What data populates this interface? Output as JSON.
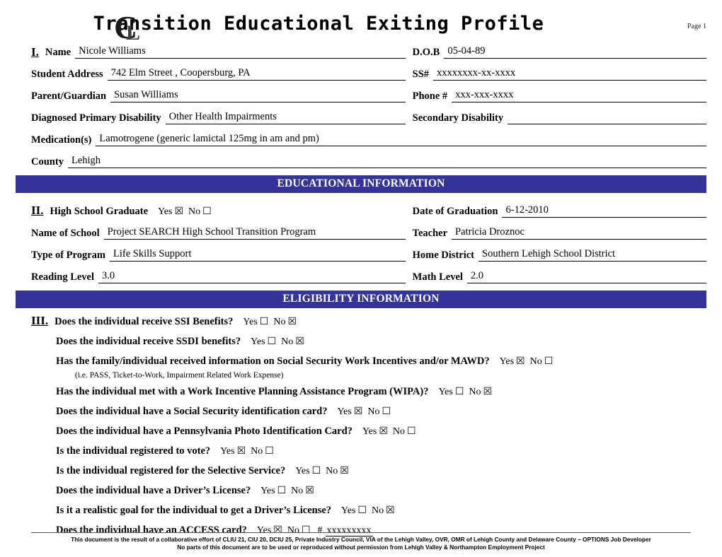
{
  "header": {
    "title": "Transition Educational Exiting Profile",
    "page_label": "Page 1",
    "logo_name": "cl-monogram-logo"
  },
  "identification": {
    "roman": "I.",
    "name_label": "Name",
    "name_value": "Nicole Williams",
    "dob_label": "D.O.B",
    "dob_value": "05-04-89",
    "address_label": "Student Address",
    "address_value": "742 Elm Street , Coopersburg, PA",
    "ssn_label": "SS#",
    "ssn_value": "xxxxxxxx-xx-xxxx",
    "parent_label": "Parent/Guardian",
    "parent_value": "Susan Williams",
    "phone_label": "Phone #",
    "phone_value": "xxx-xxx-xxxx",
    "primary_disability_label": "Diagnosed Primary Disability",
    "primary_disability_value": "Other Health Impairments",
    "secondary_disability_label": "Secondary Disability",
    "secondary_disability_value": "",
    "medication_label": "Medication(s)",
    "medication_value": "Lamotrogene (generic lamictal 125mg in am and pm)",
    "county_label": "County",
    "county_value": "Lehigh"
  },
  "educational": {
    "bar_title": "EDUCATIONAL INFORMATION",
    "roman": "II.",
    "hs_graduate_label": "High School Graduate",
    "hs_graduate_yes": "Yes",
    "hs_graduate_yes_box": "☒",
    "hs_graduate_no": "No",
    "hs_graduate_no_box": "☐",
    "grad_date_label": "Date of Graduation",
    "grad_date_value": "6-12-2010",
    "school_label": "Name of School",
    "school_value": "Project SEARCH High School Transition Program",
    "teacher_label": "Teacher",
    "teacher_value": "Patricia Droznoc",
    "program_label": "Type of Program",
    "program_value": "Life Skills Support",
    "home_district_label": "Home District",
    "home_district_value": "Southern Lehigh School District",
    "reading_label": "Reading Level",
    "reading_value": "3.0",
    "math_label": "Math Level",
    "math_value": "2.0"
  },
  "eligibility": {
    "bar_title": "ELIGIBILITY INFORMATION",
    "roman": "III.",
    "yes_label": "Yes",
    "no_label": "No",
    "questions": [
      {
        "text": "Does the individual receive SSI Benefits?",
        "yes_box": "☐",
        "no_box": "☒"
      },
      {
        "text": "Does the individual receive SSDI benefits?",
        "yes_box": "☐",
        "no_box": "☒"
      },
      {
        "text": "Has the family/individual received information on Social Security Work Incentives and/or MAWD?",
        "yes_box": "☒",
        "no_box": "☐",
        "sub": "(i.e. PASS, Ticket-to-Work, Impairment Related Work Expense)"
      },
      {
        "text": "Has the individual met with a Work Incentive Planning Assistance Program (WIPA)?",
        "yes_box": "☐",
        "no_box": "☒"
      },
      {
        "text": "Does the individual have a Social Security identification card?",
        "yes_box": "☒",
        "no_box": "☐"
      },
      {
        "text": "Does the individual have a Pennsylvania Photo Identification Card?",
        "yes_box": "☒",
        "no_box": "☐"
      },
      {
        "text": "Is the individual registered to vote?",
        "yes_box": "☒",
        "no_box": "☐"
      },
      {
        "text": "Is the individual registered for the Selective Service?",
        "yes_box": "☐",
        "no_box": "☒"
      },
      {
        "text": "Does the individual have a Driver’s License?",
        "yes_box": "☐",
        "no_box": "☒"
      },
      {
        "text": "Is it a realistic goal for the individual to get a Driver’s License?",
        "yes_box": "☐",
        "no_box": "☒"
      },
      {
        "text": "Does the individual have an ACCESS card?",
        "yes_box": "☒",
        "no_box": "☐",
        "hash_label": "#",
        "hash_value": "xxxxxxxxx"
      }
    ]
  },
  "footer": {
    "line1": "This document is the result of a collaborative effort of CLIU 21, CIU 20, DCIU 25, Private Industry Council, VIA of the Lehigh Valley, OVR, OMR of Lehigh County and Delaware County – OPTIONS Job Developer",
    "line2": "No parts of this document are to be used or reproduced without permission from Lehigh Valley & Northampton Employment Project"
  },
  "colors": {
    "section_bar": "#333399",
    "text": "#000000"
  }
}
